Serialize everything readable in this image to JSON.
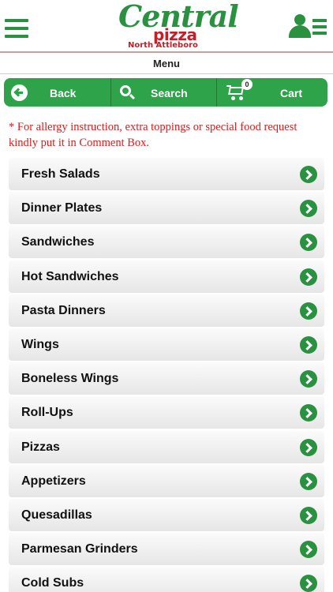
{
  "header": {
    "logo": {
      "line1": "Central",
      "line2": "pizza",
      "line3": "North Attleboro"
    }
  },
  "menubar": {
    "title": "Menu"
  },
  "nav": {
    "back_label": "Back",
    "search_label": "Search",
    "cart_label": "Cart",
    "cart_count": "0"
  },
  "notice": "* For allergy instruction, extra toppings or special food request kindly put it in Comment Box.",
  "categories": [
    "Fresh Salads",
    "Dinner Plates",
    "Sandwiches",
    "Hot Sandwiches",
    "Pasta Dinners",
    "Wings",
    "Boneless Wings",
    "Roll-Ups",
    "Pizzas",
    "Appetizers",
    "Quesadillas",
    "Parmesan Grinders",
    "Cold Subs"
  ],
  "colors": {
    "brand_green": "#2a9140",
    "nav_green": "#2ea34a",
    "brand_red": "#c21f28",
    "notice_red": "#d91c1c"
  }
}
